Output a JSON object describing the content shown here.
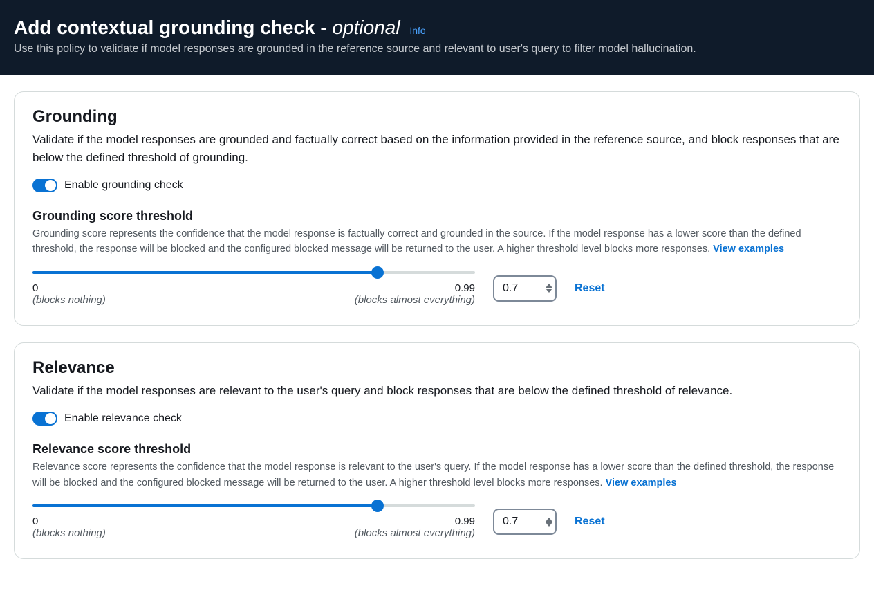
{
  "header": {
    "title_main": "Add contextual grounding check - ",
    "title_optional": "optional",
    "info": "Info",
    "subtitle": "Use this policy to validate if model responses are grounded in the reference source and relevant to user's query to filter model hallucination."
  },
  "grounding": {
    "title": "Grounding",
    "desc": "Validate if the model responses are grounded and factually correct based on the information provided in the reference source, and block responses that are below the defined threshold of grounding.",
    "toggle_label": "Enable grounding check",
    "threshold_title": "Grounding score threshold",
    "threshold_desc": "Grounding score represents the confidence that the model response is factually correct and grounded in the source. If the model response has a lower score than the defined threshold, the response will be blocked and the configured blocked message will be returned to the user. A higher threshold level blocks more responses. ",
    "view_examples": "View examples",
    "slider": {
      "min_label": "0",
      "min_hint": "(blocks nothing)",
      "max_label": "0.99",
      "max_hint": "(blocks almost everything)",
      "value": "0.7",
      "fill_pct": "78%"
    },
    "reset": "Reset"
  },
  "relevance": {
    "title": "Relevance",
    "desc": "Validate if the model responses are relevant to the user's query and block responses that are below the defined threshold of relevance.",
    "toggle_label": "Enable relevance check",
    "threshold_title": "Relevance score threshold",
    "threshold_desc": "Relevance score represents the confidence that the model response is relevant to the user's query. If the model response has a lower score than the defined threshold, the response will be blocked and the configured blocked message will be returned to the user. A higher threshold level blocks more responses.  ",
    "view_examples": "View examples",
    "slider": {
      "min_label": "0",
      "min_hint": "(blocks nothing)",
      "max_label": "0.99",
      "max_hint": "(blocks almost everything)",
      "value": "0.7",
      "fill_pct": "78%"
    },
    "reset": "Reset"
  }
}
